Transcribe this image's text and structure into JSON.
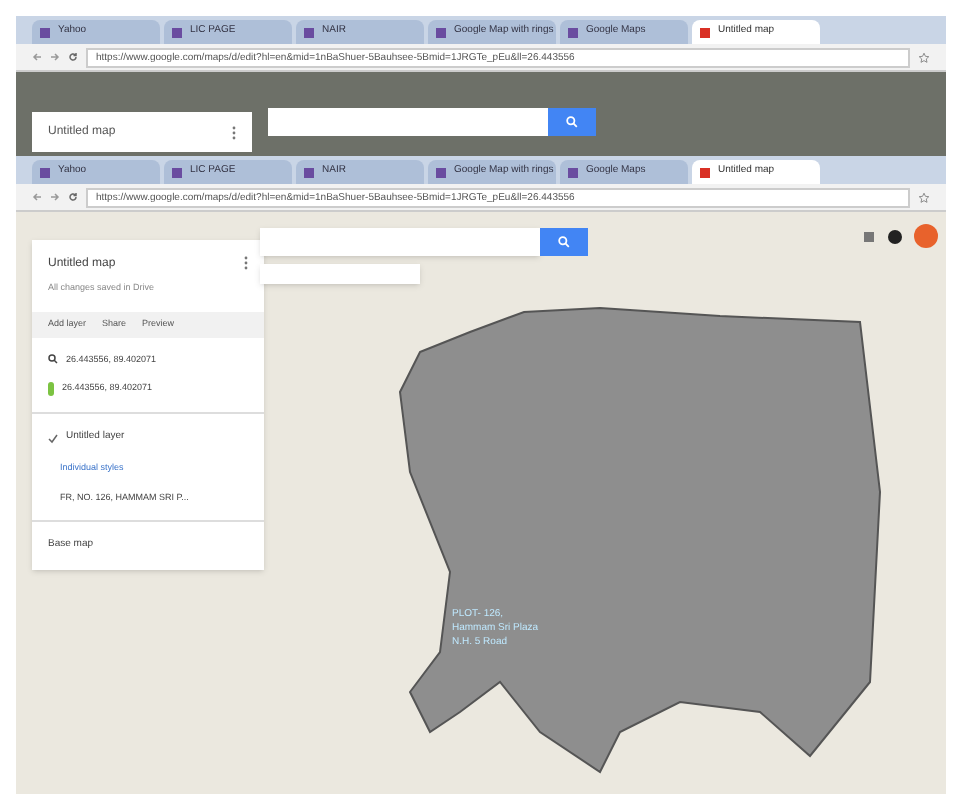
{
  "browser_windows": [
    {
      "tabs": [
        {
          "label": "Yahoo",
          "selected": false
        },
        {
          "label": "LIC PAGE",
          "selected": false
        },
        {
          "label": "NAIR",
          "selected": false
        },
        {
          "label": "Google Map with rings",
          "selected": false
        },
        {
          "label": "Google Maps",
          "selected": false
        },
        {
          "label": "Untitled map",
          "selected": true
        }
      ],
      "url": "https://www.google.com/maps/d/edit?hl=en&mid=1nBaShuer-5Bauhsee-5Bmid=1JRGTe_pEu&ll=26.443556",
      "map_title": "Untitled map"
    },
    {
      "tabs": [
        {
          "label": "Yahoo",
          "selected": false
        },
        {
          "label": "LIC PAGE",
          "selected": false
        },
        {
          "label": "NAIR",
          "selected": false
        },
        {
          "label": "Google Map with rings",
          "selected": false
        },
        {
          "label": "Google Maps",
          "selected": false
        },
        {
          "label": "Untitled map",
          "selected": true
        }
      ],
      "url": "https://www.google.com/maps/d/edit?hl=en&mid=1nBaShuer-5Bauhsee-5Bmid=1JRGTe_pEu&ll=26.443556"
    }
  ],
  "panel": {
    "title": "Untitled map",
    "subtitle": "All changes saved in Drive",
    "actions": [
      "Add layer",
      "Share",
      "Preview"
    ],
    "search_result": "26.443556, 89.402071",
    "pin_label": "26.443556, 89.402071",
    "layer": {
      "name": "Untitled layer",
      "checked": true,
      "style": "Individual styles",
      "feature": "FR, NO. 126, HAMMAM SRI P..."
    },
    "base_map": "Base map"
  },
  "map_label": [
    "PLOT- 126,",
    "Hammam Sri Plaza",
    "N.H. 5 Road"
  ]
}
